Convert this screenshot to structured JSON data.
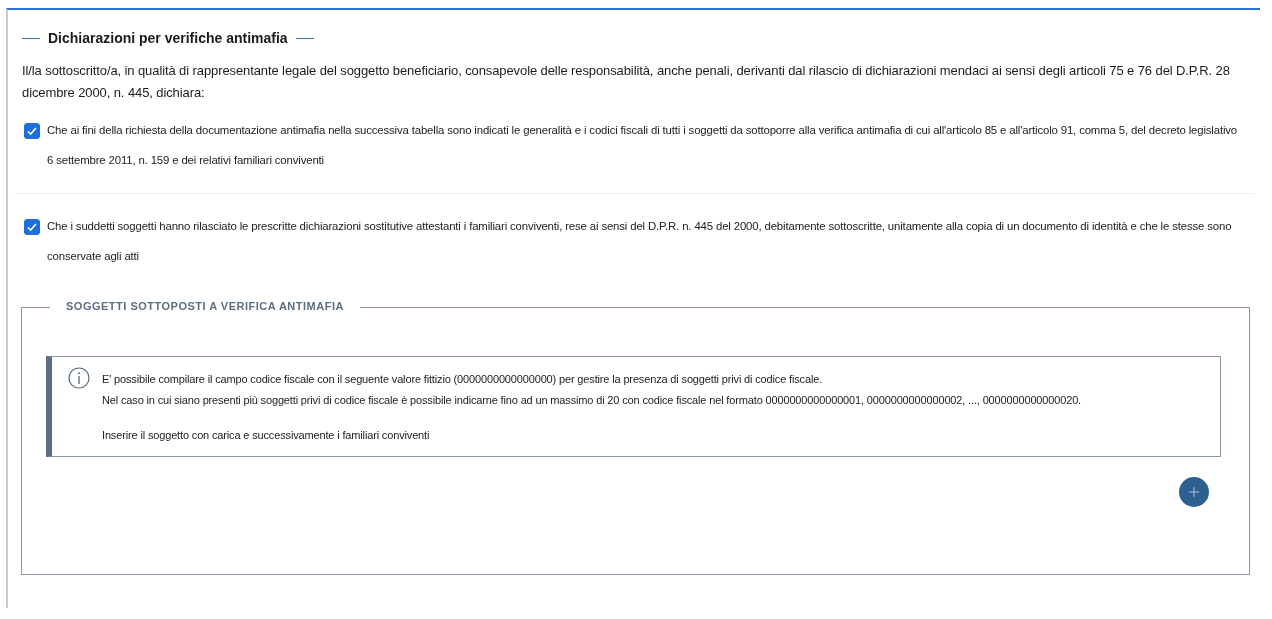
{
  "section": {
    "title": "Dichiarazioni per verifiche antimafia",
    "intro": "Il/la sottoscritto/a, in qualità di rappresentante legale del soggetto beneficiario, consapevole delle responsabilità, anche penali, derivanti dal rilascio di dichiarazioni mendaci ai sensi degli articoli 75 e 76 del D.P.R. 28 dicembre 2000, n. 445, dichiara:",
    "declarations": [
      {
        "label": "Che ai fini della richiesta della documentazione antimafia nella successiva tabella sono indicati le generalità e i codici fiscali di tutti i soggetti da sottoporre alla verifica antimafia di cui all'articolo 85 e all'articolo 91, comma 5, del decreto legislativo 6 settembre 2011, n. 159 e dei relativi familiari conviventi",
        "checked": true
      },
      {
        "label": "Che i suddetti soggetti hanno rilasciato le prescritte dichiarazioni sostitutive attestanti i familiari conviventi, rese ai sensi del D.P.R. n. 445 del 2000, debitamente sottoscritte, unitamente alla copia di un documento di identità e che le stesse sono conservate agli atti",
        "checked": true
      }
    ],
    "subjects": {
      "legend": "SOGGETTI SOTTOPOSTI A VERIFICA ANTIMAFIA",
      "info": [
        "E' possibile compilare il campo codice fiscale con il seguente valore fittizio (0000000000000000) per gestire la presenza di soggetti privi di codice fiscale.",
        "Nel caso in cui siano presenti più soggetti privi di codice fiscale è possibile indicarne fino ad un massimo di 20 con codice fiscale nel formato 0000000000000001, 0000000000000002, ..., 0000000000000020.",
        "Inserire il soggetto con carica e successivamente i familiari conviventi"
      ]
    }
  }
}
